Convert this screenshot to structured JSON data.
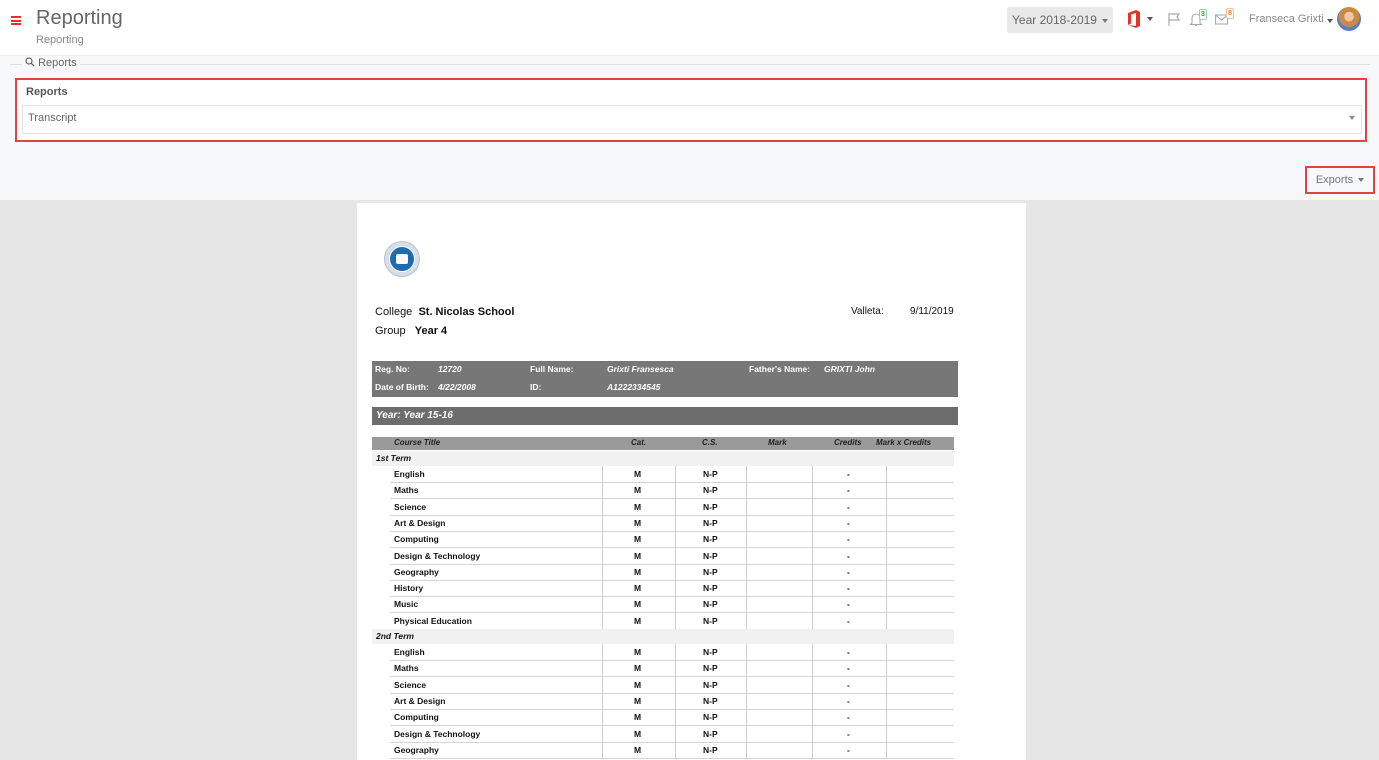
{
  "header": {
    "title": "Reporting",
    "subtitle": "Reporting",
    "year_selector": "Year 2018-2019",
    "notifications_count": "3",
    "messages_count": "8",
    "user_name": "Franseca Grixti"
  },
  "panel": {
    "legend": "Reports",
    "field_label": "Reports",
    "selected_report": "Transcript",
    "exports_label": "Exports"
  },
  "document": {
    "college_label": "College",
    "college_name": "St. Nicolas School",
    "group_label": "Group",
    "group_name": "Year 4",
    "place": "Valleta:",
    "date": "9/11/2019",
    "info": {
      "reg_no_label": "Reg. No:",
      "reg_no": "12720",
      "full_name_label": "Full Name:",
      "full_name": "Grixti Fransesca",
      "father_label": "Father's Name:",
      "father_name": "GRIXTI John",
      "dob_label": "Date of Birth:",
      "dob": "4/22/2008",
      "id_label": "ID:",
      "id": "A1222334545"
    },
    "year_bar": "Year: Year 15-16",
    "columns": [
      "Course Title",
      "Cat.",
      "C.S.",
      "Mark",
      "Credits",
      "Mark x Credits"
    ],
    "terms": [
      {
        "name": "1st Term",
        "rows": [
          {
            "course": "English",
            "cat": "M",
            "cs": "N-P",
            "mark": "",
            "credits": "-"
          },
          {
            "course": "Maths",
            "cat": "M",
            "cs": "N-P",
            "mark": "",
            "credits": "-"
          },
          {
            "course": "Science",
            "cat": "M",
            "cs": "N-P",
            "mark": "",
            "credits": "-"
          },
          {
            "course": "Art & Design",
            "cat": "M",
            "cs": "N-P",
            "mark": "",
            "credits": "-"
          },
          {
            "course": "Computing",
            "cat": "M",
            "cs": "N-P",
            "mark": "",
            "credits": "-"
          },
          {
            "course": "Design & Technology",
            "cat": "M",
            "cs": "N-P",
            "mark": "",
            "credits": "-"
          },
          {
            "course": "Geography",
            "cat": "M",
            "cs": "N-P",
            "mark": "",
            "credits": "-"
          },
          {
            "course": "History",
            "cat": "M",
            "cs": "N-P",
            "mark": "",
            "credits": "-"
          },
          {
            "course": "Music",
            "cat": "M",
            "cs": "N-P",
            "mark": "",
            "credits": "-"
          },
          {
            "course": "Physical Education",
            "cat": "M",
            "cs": "N-P",
            "mark": "",
            "credits": "-"
          }
        ]
      },
      {
        "name": "2nd Term",
        "rows": [
          {
            "course": "English",
            "cat": "M",
            "cs": "N-P",
            "mark": "",
            "credits": "-"
          },
          {
            "course": "Maths",
            "cat": "M",
            "cs": "N-P",
            "mark": "",
            "credits": "-"
          },
          {
            "course": "Science",
            "cat": "M",
            "cs": "N-P",
            "mark": "",
            "credits": "-"
          },
          {
            "course": "Art & Design",
            "cat": "M",
            "cs": "N-P",
            "mark": "",
            "credits": "-"
          },
          {
            "course": "Computing",
            "cat": "M",
            "cs": "N-P",
            "mark": "",
            "credits": "-"
          },
          {
            "course": "Design & Technology",
            "cat": "M",
            "cs": "N-P",
            "mark": "",
            "credits": "-"
          },
          {
            "course": "Geography",
            "cat": "M",
            "cs": "N-P",
            "mark": "",
            "credits": "-"
          }
        ]
      }
    ]
  },
  "icons": [
    "menu-icon",
    "search-icon",
    "office-icon",
    "flag-icon",
    "bell-icon",
    "mail-icon",
    "school-logo-icon"
  ],
  "colors": {
    "accent": "#e5322d",
    "info_bar": "#777777",
    "year_bar": "#6d6d6d",
    "table_header": "#9a9a9a"
  }
}
